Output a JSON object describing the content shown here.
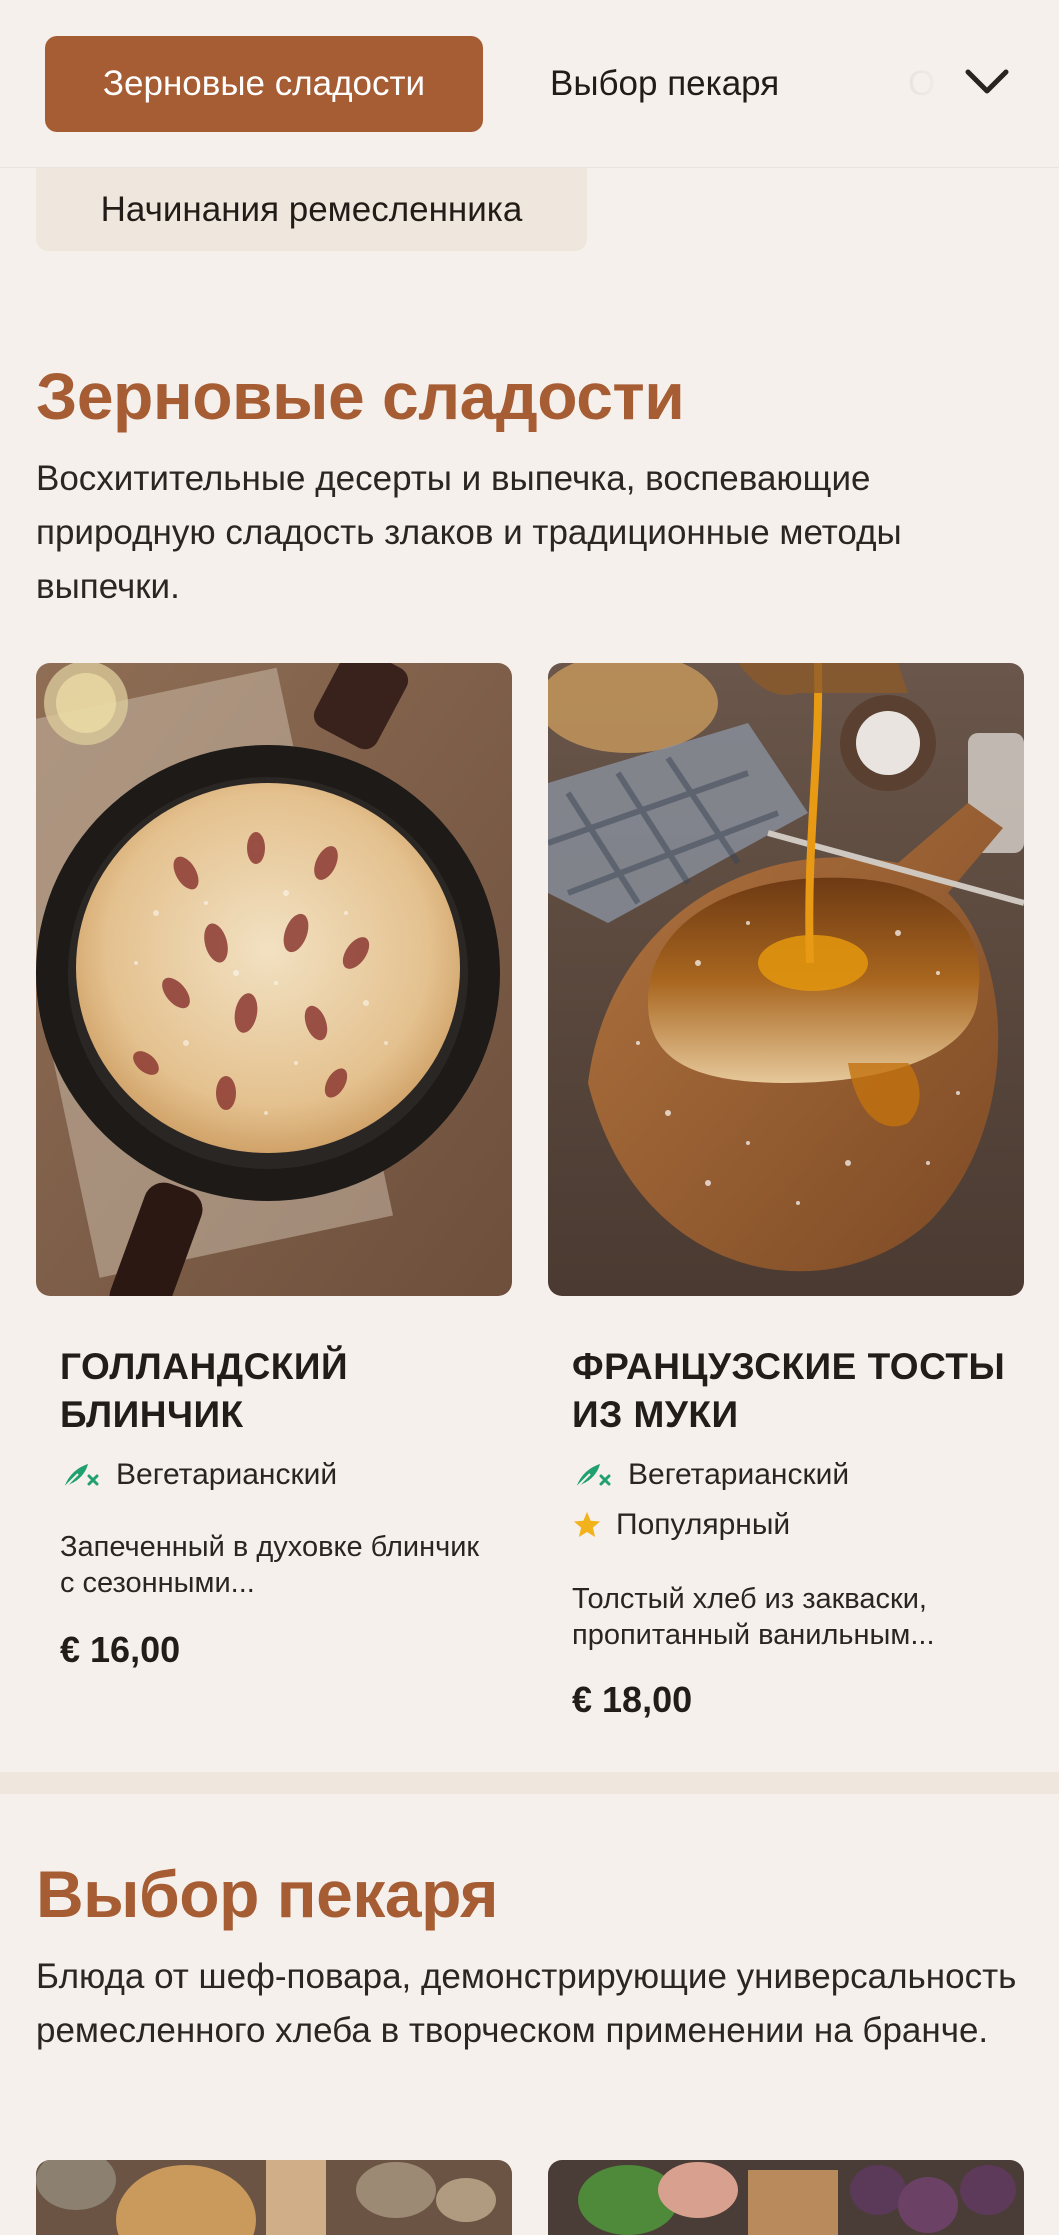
{
  "nav": {
    "tabs": [
      {
        "label": "Зерновые сладости",
        "active": true
      },
      {
        "label": "Выбор пекаря",
        "active": false
      },
      {
        "label": "О",
        "active": false
      }
    ],
    "chip": "Начинания ремесленника",
    "chevron_icon": "chevron-down-icon"
  },
  "colors": {
    "accent": "#a65d33",
    "background": "#f6f0ec",
    "vegetarian_icon": "#1fa06d",
    "popular_star": "#f2b21b"
  },
  "sections": [
    {
      "title": "Зерновые сладости",
      "description": "Восхитительные десерты и выпечка, воспевающие природную сладость злаков и традиционные методы выпечки.",
      "items": [
        {
          "name": "ГОЛЛАНДСКИЙ БЛИНЧИК",
          "tags": [
            {
              "label": "Вегетарианский",
              "icon": "vegetarian-icon"
            }
          ],
          "description": "Запеченный в духовке блинчик с сезонными...",
          "price": "€ 16,00"
        },
        {
          "name": "ФРАНЦУЗСКИЕ ТОСТЫ ИЗ МУКИ",
          "tags": [
            {
              "label": "Вегетарианский",
              "icon": "vegetarian-icon"
            },
            {
              "label": "Популярный",
              "icon": "star-icon"
            }
          ],
          "description": "Толстый хлеб из закваски, пропитанный ванильным...",
          "price": "€ 18,00"
        }
      ]
    },
    {
      "title": "Выбор пекаря",
      "description": "Блюда от шеф-повара, демонстрирующие универсальность ремесленного хлеба в творческом применении на бранче."
    }
  ]
}
